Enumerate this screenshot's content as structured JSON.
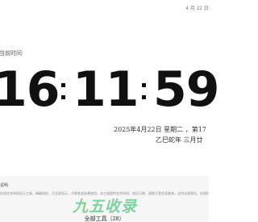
{
  "header": {
    "date_short": "4 月 22 日"
  },
  "clock": {
    "label": "当前时间:",
    "hours": "16",
    "minutes": "11",
    "seconds": "59"
  },
  "date": {
    "gregorian": "2025年4月22日 星期二 ，第17",
    "lunar": "乙巳蛇年 三月廿"
  },
  "footer": {
    "title": "说明",
    "description": "在线北京时间显示工具，精确到秒，可全屏显示，方便各类场景使用。本工具提供北京时间、农历日期、星期几等信息查询，支持全屏模式，在线时钟，倒计时等。",
    "brand": "九五收录",
    "tools_link": "全部工具（28）"
  },
  "colors": {
    "brand": "#21b35b",
    "digits": "#111111",
    "footer_bg": "#f6f6f6"
  }
}
